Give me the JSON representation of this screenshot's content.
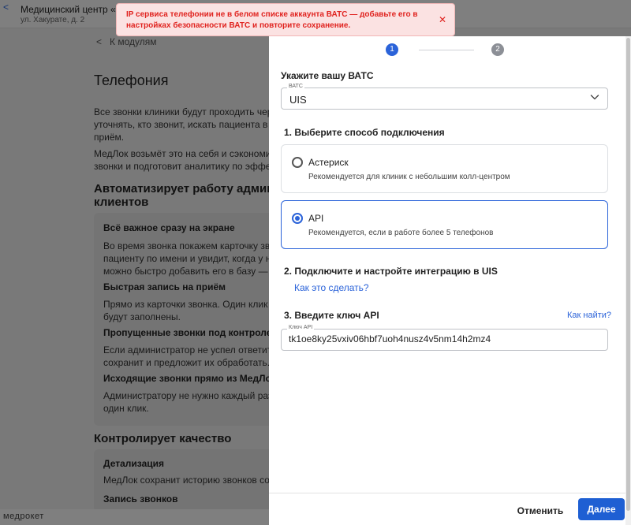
{
  "background": {
    "header": {
      "clinic_name": "Медицинский центр «Тес",
      "clinic_address": "ул. Хакурате, д. 2"
    },
    "breadcrumb": "К модулям",
    "title": "Телефония",
    "intro_lines": [
      "Все звонки клиники будут проходить чер",
      "уточнять, кто звонит, искать пациента в",
      "приём."
    ],
    "intro2_lines": [
      "МедЛок возьмёт это на себя и сэкономи",
      "звонки и подготовит аналитику по эффе"
    ],
    "section1_title_lines": [
      "Автоматизирует работу админ",
      "клиентов"
    ],
    "features": [
      {
        "title": "Всё важное сразу на экране",
        "lines": [
          "Во время звонка покажем карточку зво",
          "пациенту по имени и увидит, когда у не",
          "можно быстро добавить его в базу — н"
        ]
      },
      {
        "title": "Быстрая запись на приём",
        "lines": [
          "Прямо из карточки звонка. Один клик -",
          "будут заполнены."
        ]
      },
      {
        "title": "Пропущенные звонки под контролем",
        "lines": [
          "Если администратор не успел ответить",
          "сохранит и предложит их обработать."
        ]
      },
      {
        "title": "Исходящие звонки прямо из МедЛока",
        "lines": [
          "Администратору не нужно каждый раз",
          "один клик."
        ]
      }
    ],
    "section2_title": "Контролирует качество",
    "quality": [
      {
        "title": "Детализация",
        "lines": [
          "МедЛок сохранит историю звонков со"
        ]
      },
      {
        "title": "Запись звонков",
        "lines": []
      }
    ],
    "brand": "медрокет"
  },
  "toast": {
    "message": "IP сервиса телефонии не в белом списке аккаунта ВАТС — добавьте его в настройках безопасности ВАТС и повторите сохранение.",
    "close_symbol": "✕"
  },
  "drawer": {
    "steps": [
      "1",
      "2"
    ],
    "vats_heading": "Укажите вашу ВАТС",
    "vats_select": {
      "legend": "ВАТС",
      "value": "UIS"
    },
    "step1_heading": "1. Выберите способ подключения",
    "options": [
      {
        "title": "Астериск",
        "subtitle": "Рекомендуется для клиник с небольшим колл-центром",
        "selected": false
      },
      {
        "title": "API",
        "subtitle": "Рекомендуется, если в работе более 5 телефонов",
        "selected": true
      }
    ],
    "step2_heading": "2. Подключите и настройте интеграцию в UIS",
    "how_link": "Как это сделать?",
    "step3_heading": "3. Введите ключ API",
    "where_link": "Как найти?",
    "api_key": {
      "legend": "Ключ API",
      "value": "tk1oe8ky25vxiv06hbf7uoh4nusz4v5nm14h2mz4"
    },
    "cancel_label": "Отменить",
    "next_label": "Далее"
  },
  "colors": {
    "accent": "#2b63d9",
    "error_text": "#e0231f",
    "error_bg": "#fbe2e2"
  }
}
